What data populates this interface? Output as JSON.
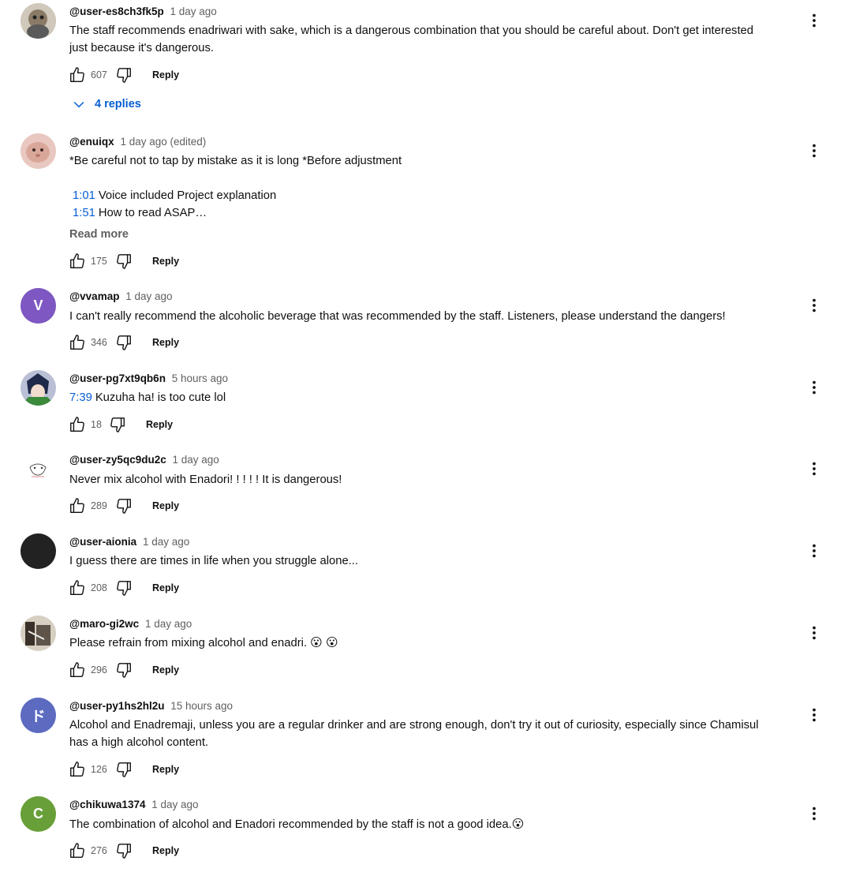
{
  "icons": {
    "like": "thumb-up-icon",
    "dislike": "thumb-down-icon",
    "menu": "more-vert-icon",
    "expand": "chevron-down-icon"
  },
  "colors": {
    "link_blue": "#065fd4",
    "secondary_text": "#606060"
  },
  "comments": [
    {
      "author": "@user-es8ch3fk5p",
      "time": "1 day ago",
      "lines": [
        "The staff recommends enadriwari with sake, which is a dangerous combination that you should be careful about. Don't get interested",
        "just because it's dangerous."
      ],
      "likes": "607",
      "reply_label": "Reply",
      "replies_label": "4 replies"
    },
    {
      "author": "@enuiqx",
      "time": "1 day ago (edited)",
      "lines": [
        "*Be careful not to tap by mistake as it is long *Before adjustment",
        ""
      ],
      "chapters": [
        {
          "ts": "1:01",
          "text": "Voice included Project explanation"
        },
        {
          "ts": "1:51",
          "text": "How to read ASAP…"
        }
      ],
      "read_more": "Read more",
      "likes": "175",
      "reply_label": "Reply"
    },
    {
      "author": "@vvamap",
      "time": "1 day ago",
      "avatar_letter": "V",
      "lines": [
        "I can't really recommend the alcoholic beverage that was recommended by the staff. Listeners, please understand the dangers!"
      ],
      "likes": "346",
      "reply_label": "Reply"
    },
    {
      "author": "@user-pg7xt9qb6n",
      "time": "5 hours ago",
      "ts": "7:39",
      "ts_text": "Kuzuha ha! is too cute lol",
      "likes": "18",
      "reply_label": "Reply"
    },
    {
      "author": "@user-zy5qc9du2c",
      "time": "1 day ago",
      "lines": [
        "Never mix alcohol with Enadori! ! ! ! ! It is dangerous!"
      ],
      "likes": "289",
      "reply_label": "Reply"
    },
    {
      "author": "@user-aionia",
      "time": "1 day ago",
      "lines": [
        "I guess there are times in life when you struggle alone..."
      ],
      "likes": "208",
      "reply_label": "Reply"
    },
    {
      "author": "@maro-gi2wc",
      "time": "1 day ago",
      "text": "Please refrain from mixing alcohol and enadri.",
      "emoji": "😮 😮",
      "likes": "296",
      "reply_label": "Reply"
    },
    {
      "author": "@user-py1hs2hl2u",
      "time": "15 hours ago",
      "avatar_letter": "ド",
      "lines": [
        "Alcohol and Enadremaji, unless you are a regular drinker and are strong enough, don't try it out of curiosity, especially since Chamisul",
        "has a high alcohol content."
      ],
      "likes": "126",
      "reply_label": "Reply"
    },
    {
      "author": "@chikuwa1374",
      "time": "1 day ago",
      "avatar_letter": "C",
      "text": "The combination of alcohol and Enadori recommended by the staff is not a good idea.",
      "emoji": "😮",
      "likes": "276",
      "reply_label": "Reply"
    }
  ]
}
